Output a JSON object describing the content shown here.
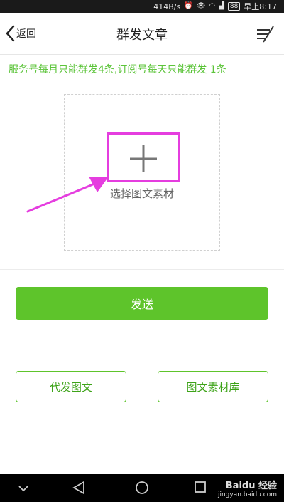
{
  "status_bar": {
    "network_speed": "414B/s",
    "battery": "88",
    "time": "早上8:17"
  },
  "nav": {
    "back_label": "返回",
    "title": "群发文章"
  },
  "notice": "服务号每月只能群发4条,订阅号每天只能群发 1条",
  "picker": {
    "label": "选择图文素材"
  },
  "send_label": "发送",
  "buttons": {
    "proxy_post": "代发图文",
    "library": "图文素材库"
  },
  "watermark": {
    "main": "Baidu 经验",
    "url": "jingyan.baidu.com"
  },
  "colors": {
    "accent_green": "#5ec42b",
    "annotation_magenta": "#e53ddf"
  }
}
